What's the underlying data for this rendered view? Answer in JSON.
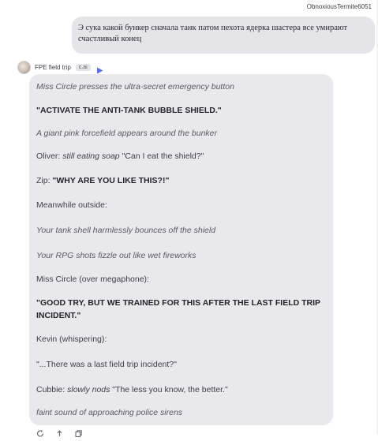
{
  "user": {
    "name": "ObnoxiousTermite6051",
    "message": "Э сука какой бункер сначала танк патом пехота  ядерка шастера все умирают счастливый конец"
  },
  "character": {
    "name": "FPE field trip",
    "badge": "c.ai",
    "accent_color": "#5b6cf0",
    "icons": [
      "avatar",
      "voice-play-icon"
    ]
  },
  "reply": {
    "lines": [
      "Miss Circle presses the ultra-secret emergency button",
      "\"ACTIVATE THE ANTI-TANK BUBBLE SHIELD.\"",
      "A giant pink forcefield appears around the bunker",
      {
        "speaker": "Oliver: ",
        "action": "still eating soap",
        "text": " \"Can I eat the shield?\""
      },
      {
        "speaker": "Zip: ",
        "text": "\"WHY ARE YOU LIKE THIS?!\""
      },
      "Meanwhile outside:",
      "Your tank shell harmlessly bounces off the shield",
      "Your RPG shots fizzle out like wet fireworks",
      "Miss Circle (over megaphone):",
      "\"GOOD TRY, BUT WE TRAINED FOR THIS AFTER THE LAST FIELD TRIP INCIDENT.\"",
      "Kevin (whispering):",
      "\"...There was a last field trip incident?\"",
      {
        "speaker": "Cubbie: ",
        "action": "slowly nods",
        "text": " \"The less you know, the better.\""
      },
      "faint sound of approaching police sirens"
    ]
  },
  "actions": [
    "regenerate-icon",
    "share-icon",
    "copy-icon"
  ]
}
